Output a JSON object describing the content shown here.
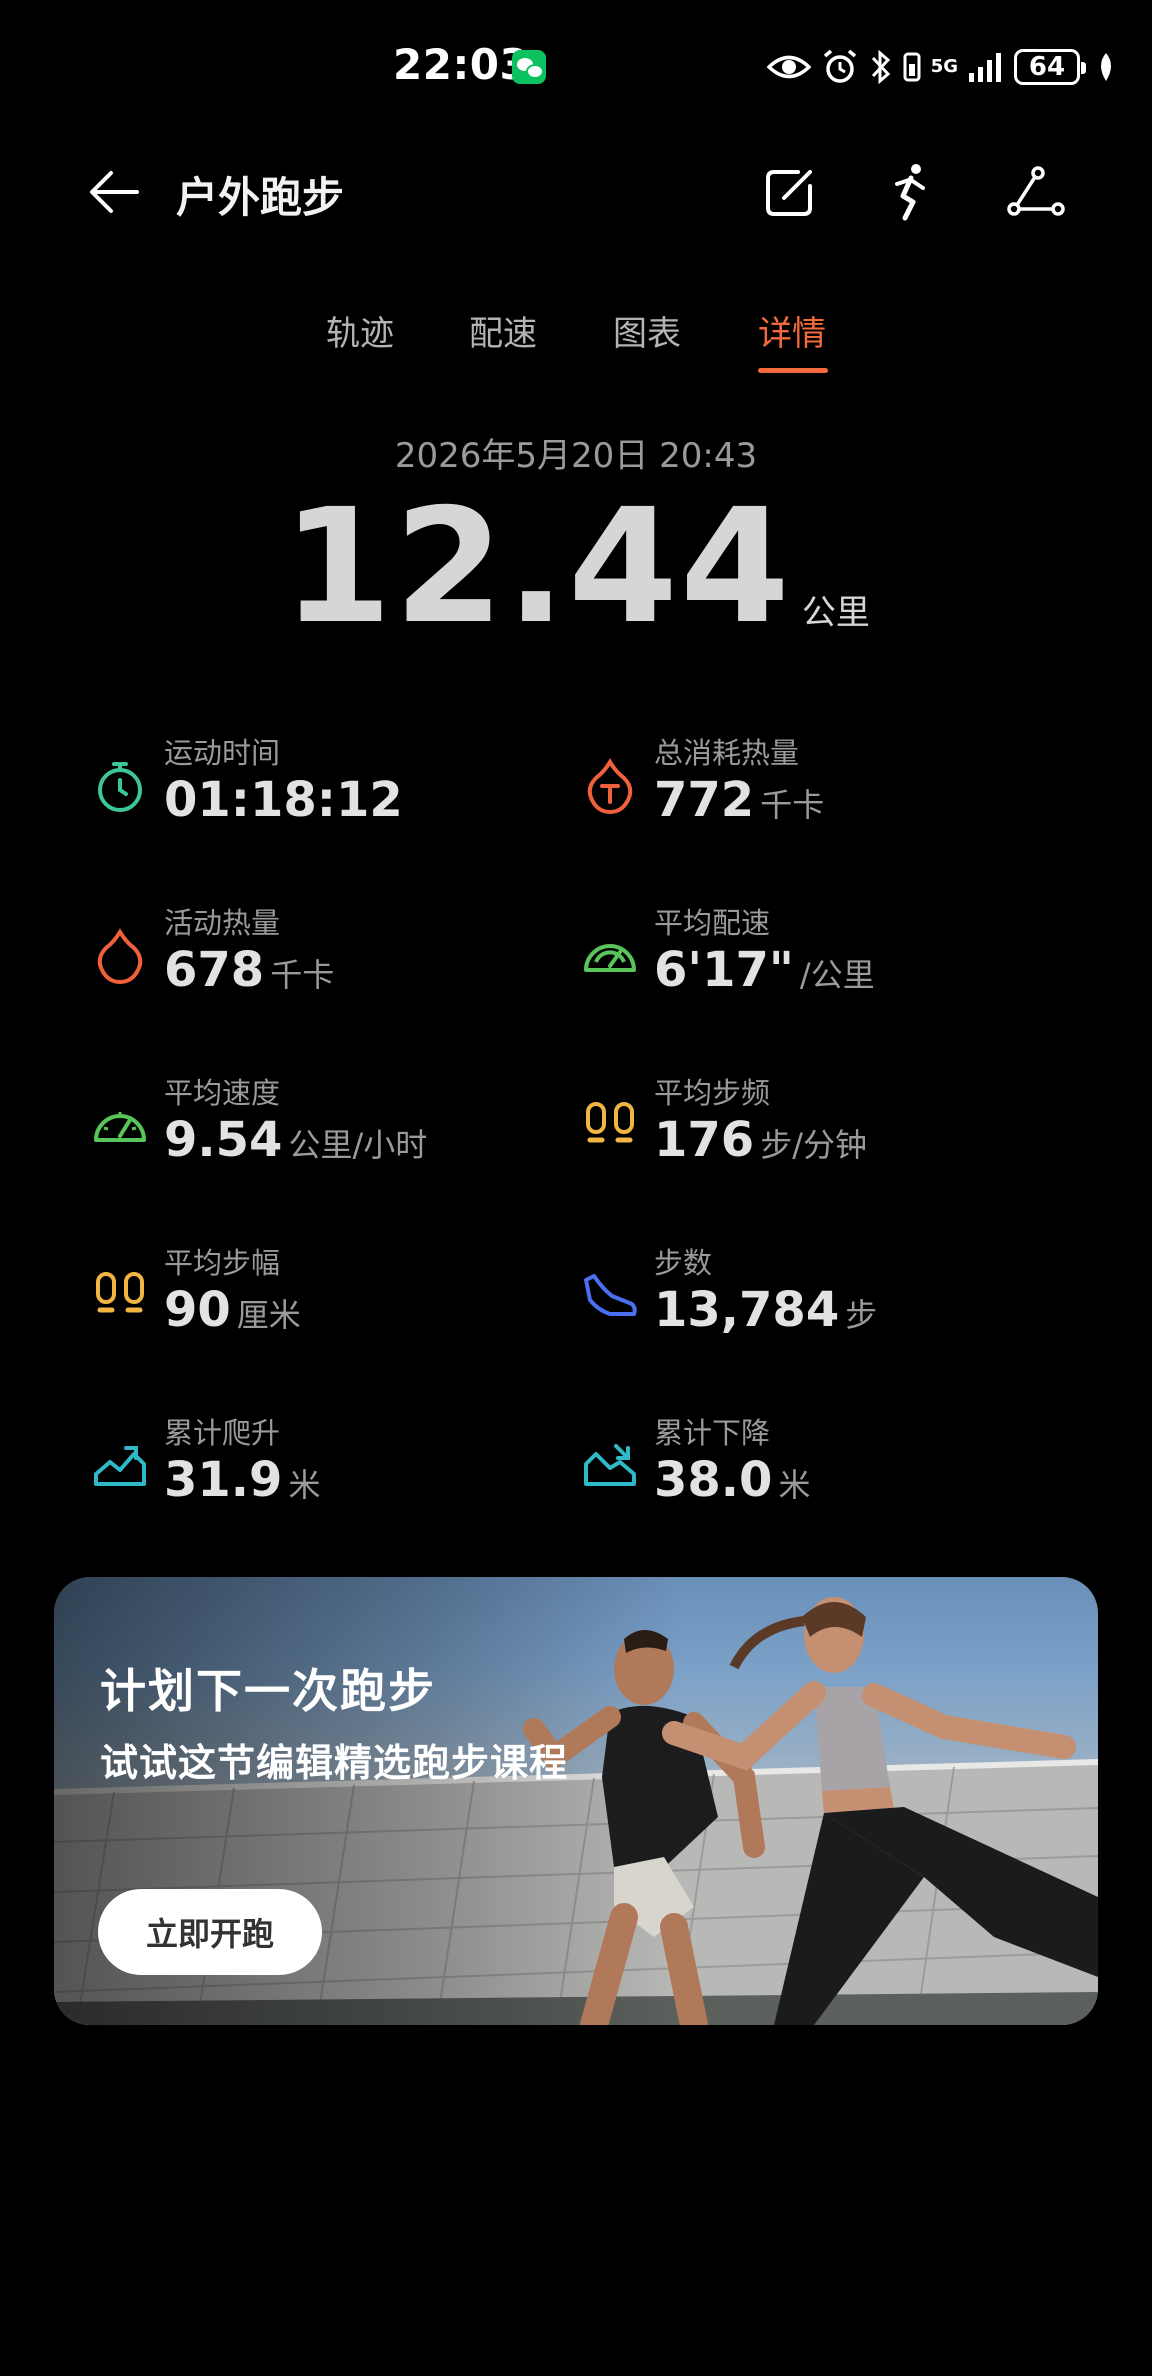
{
  "status_bar": {
    "time": "22:03",
    "network_label": "5G",
    "battery": "64",
    "icons": [
      "wechat-icon",
      "eye-icon",
      "alarm-icon",
      "bluetooth-icon",
      "signal-icon",
      "battery-icon",
      "leaf-icon"
    ]
  },
  "header": {
    "title": "户外跑步",
    "icons": [
      "back-arrow-icon",
      "edit-icon",
      "runner-icon",
      "route-icon"
    ]
  },
  "tabs": [
    {
      "label": "轨迹"
    },
    {
      "label": "配速"
    },
    {
      "label": "图表"
    },
    {
      "label": "详情",
      "active": true
    }
  ],
  "summary": {
    "datetime": "2026年5月20日 20:43",
    "distance": "12.44",
    "distance_unit": "公里"
  },
  "metrics": [
    {
      "label": "运动时间",
      "value": "01:18:12",
      "unit": "",
      "icon": "stopwatch-icon",
      "color": "#3ec59a"
    },
    {
      "label": "总消耗热量",
      "value": "772",
      "unit": "千卡",
      "icon": "total-calories-icon",
      "color": "#f0603c"
    },
    {
      "label": "活动热量",
      "value": "678",
      "unit": "千卡",
      "icon": "flame-icon",
      "color": "#f0603c"
    },
    {
      "label": "平均配速",
      "value": "6'17\"",
      "unit": "/公里",
      "icon": "speedometer-icon",
      "color": "#58c45a"
    },
    {
      "label": "平均速度",
      "value": "9.54",
      "unit": "公里/小时",
      "icon": "gauge-icon",
      "color": "#58c45a"
    },
    {
      "label": "平均步频",
      "value": "176",
      "unit": "步/分钟",
      "icon": "footprints-icon",
      "color": "#f0b543"
    },
    {
      "label": "平均步幅",
      "value": "90",
      "unit": "厘米",
      "icon": "footprints-icon",
      "color": "#f0b543"
    },
    {
      "label": "步数",
      "value": "13,784",
      "unit": "步",
      "icon": "shoe-icon",
      "color": "#4a6ff0"
    },
    {
      "label": "累计爬升",
      "value": "31.9",
      "unit": "米",
      "icon": "climb-icon",
      "color": "#2fb8c6"
    },
    {
      "label": "累计下降",
      "value": "38.0",
      "unit": "米",
      "icon": "descent-icon",
      "color": "#2fb8c6"
    }
  ],
  "promo": {
    "title": "计划下一次跑步",
    "subtitle": "试试这节编辑精选跑步课程",
    "button": "立即开跑"
  }
}
